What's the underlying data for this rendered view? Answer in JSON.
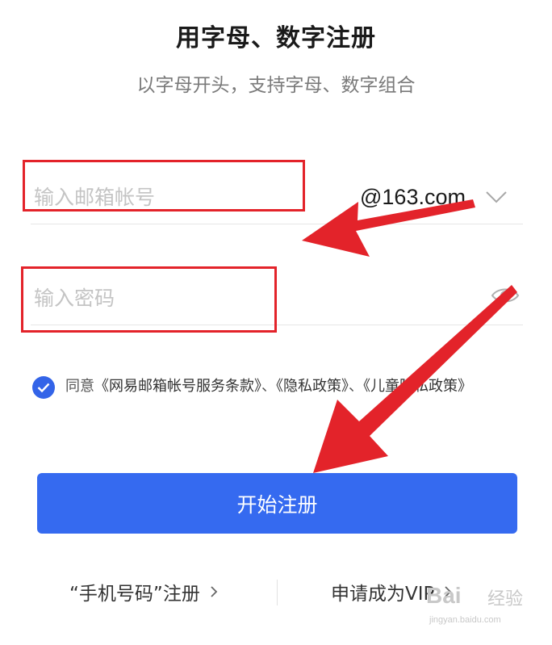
{
  "header": {
    "title": "用字母、数字注册",
    "subtitle": "以字母开头，支持字母、数字组合"
  },
  "form": {
    "email": {
      "value": "",
      "placeholder": "输入邮箱帐号",
      "domain": "@163.com",
      "domain_icon": "chevron-down-icon"
    },
    "password": {
      "value": "",
      "placeholder": "输入密码",
      "toggle_icon": "eye-icon"
    },
    "agreement": {
      "checked": true,
      "prefix": "同意",
      "terms": "《网易邮箱帐号服务条款》",
      "sep": "、",
      "privacy": "《隐私政策》",
      "sep2": "、",
      "children": "《儿童隐私政策》"
    },
    "submit_label": "开始注册"
  },
  "footer": {
    "phone_register": "“手机号码”注册",
    "vip": "申请成为VIP"
  },
  "watermark": {
    "brand": "Bai",
    "cn": "经验",
    "url": "jingyan.baidu.com"
  },
  "colors": {
    "primary": "#356af0",
    "check": "#3364e8",
    "annotation": "#e3232a"
  }
}
